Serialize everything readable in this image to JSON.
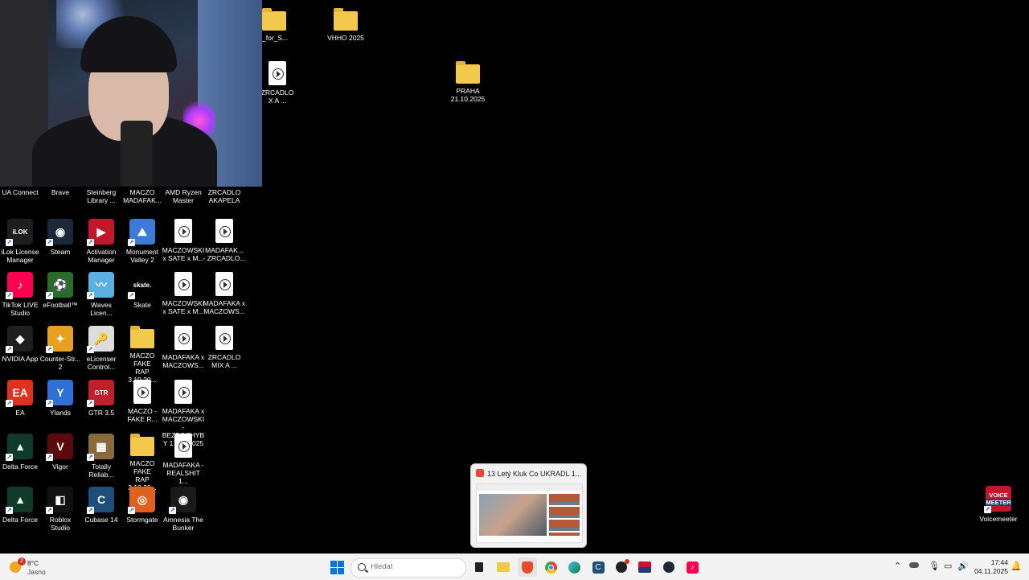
{
  "desktop": {
    "top_icons": [
      {
        "label": "_for_S..."
      },
      {
        "label": "VHHO 2025"
      },
      {
        "label": "ZRCADLO\nX A ..."
      },
      {
        "label": "PRAHA\n21.10.2025"
      }
    ],
    "grid": [
      [
        {
          "label": "UA Connect",
          "type": "app",
          "color": "#111111",
          "glyph": ""
        },
        {
          "label": "Brave",
          "type": "app",
          "color": "#e74a2d",
          "glyph": ""
        },
        {
          "label": "Steinberg\nLibrary ...",
          "type": "app",
          "color": "#333333",
          "glyph": ""
        },
        {
          "label": "MACZO\nMADAFAK...",
          "type": "app",
          "color": "#222222",
          "glyph": ""
        },
        {
          "label": "AMD Ryzen\nMaster",
          "type": "app",
          "color": "#222222",
          "glyph": ""
        },
        {
          "label": "ZRCADLO\nAKAPELA",
          "type": "app",
          "color": "#222222",
          "glyph": ""
        }
      ],
      [
        {
          "label": "iLok License\nManager",
          "type": "app",
          "color": "#1e1e1e",
          "glyph": "iLOK"
        },
        {
          "label": "Steam",
          "type": "app",
          "color": "#1b2838",
          "glyph": "◉"
        },
        {
          "label": "Activation\nManager",
          "type": "app",
          "color": "#c4162a",
          "glyph": "▶"
        },
        {
          "label": "Monument\nValley 2",
          "type": "app",
          "color": "#3a7bd5",
          "glyph": "⛰"
        },
        {
          "label": "MACZOWSKI\nx SATE x M...",
          "type": "file"
        },
        {
          "label": "MADAFAK...\n- ZRCADLO...",
          "type": "file"
        }
      ],
      [
        {
          "label": "TikTok LIVE\nStudio",
          "type": "app",
          "color": "#ff0050",
          "glyph": "♪"
        },
        {
          "label": "eFootball™",
          "type": "app",
          "color": "#2a6b2a",
          "glyph": "⚽"
        },
        {
          "label": "Waves\nLicen...",
          "type": "app",
          "color": "#5ab0e0",
          "glyph": "〰"
        },
        {
          "label": "Skate",
          "type": "app",
          "color": "#000000",
          "glyph": "skate."
        },
        {
          "label": "MACZOWSKI\nx SATE x M...",
          "type": "file"
        },
        {
          "label": "MADAFAKA x\nMACZOWS...",
          "type": "file"
        }
      ],
      [
        {
          "label": "NVIDIA App",
          "type": "app",
          "color": "#1f1f1f",
          "glyph": "◆"
        },
        {
          "label": "Counter-Str...\n2",
          "type": "app",
          "color": "#e8a020",
          "glyph": "✦"
        },
        {
          "label": "eLicenser\nControl...",
          "type": "app",
          "color": "#dddddd",
          "glyph": "🔑"
        },
        {
          "label": "MACZO FAKE\nRAP 3.10.20...",
          "type": "folder"
        },
        {
          "label": "MADAFAKA x\nMACZOWS...",
          "type": "file"
        },
        {
          "label": "ZRCADLO\nMIX A ...",
          "type": "file"
        }
      ],
      [
        {
          "label": "EA",
          "type": "app",
          "color": "#e0301e",
          "glyph": "EA"
        },
        {
          "label": "Ylands",
          "type": "app",
          "color": "#2e6fd8",
          "glyph": "Y"
        },
        {
          "label": "GTR 3.5",
          "type": "app",
          "color": "#c0202a",
          "glyph": "GTR"
        },
        {
          "label": "MACZO -\nFAKE R...",
          "type": "file"
        },
        {
          "label": "MADAFAKA x\nMACZOWSKI\n- BEZPOCHYB\nY 17.10.2025",
          "type": "file"
        }
      ],
      [
        {
          "label": "Delta Force",
          "type": "app",
          "color": "#0f3b2a",
          "glyph": "▲"
        },
        {
          "label": "Vigor",
          "type": "app",
          "color": "#5a0a0a",
          "glyph": "V"
        },
        {
          "label": "Totally\nReliab...",
          "type": "app",
          "color": "#8a6a3a",
          "glyph": "▦"
        },
        {
          "label": "MACZO FAKE\nRAP 3.10.20...",
          "type": "folder"
        },
        {
          "label": "MADAFAKA -\nREALSHIT 1...",
          "type": "file"
        }
      ],
      [
        {
          "label": "Delta Force",
          "type": "app",
          "color": "#0f3b2a",
          "glyph": "▲"
        },
        {
          "label": "Roblox\nStudio",
          "type": "app",
          "color": "#111111",
          "glyph": "◧"
        },
        {
          "label": "Cubase 14",
          "type": "app",
          "color": "#1f4e7a",
          "glyph": "C"
        },
        {
          "label": "Stormgate",
          "type": "app",
          "color": "#e0601e",
          "glyph": "◎"
        },
        {
          "label": "Amnesia The\nBunker",
          "type": "app",
          "color": "#1a1a1a",
          "glyph": "◉"
        }
      ]
    ],
    "voicemeeter": {
      "label": "Voicemeeter",
      "logo_top": "VOICE",
      "logo_bottom": "MEETER"
    }
  },
  "preview": {
    "title": "13 Letý Kluk Co UKRADL 1..."
  },
  "taskbar": {
    "weather": {
      "temp": "8°C",
      "condition": "Jasno",
      "badge": "2"
    },
    "search": {
      "placeholder": "Hledat"
    },
    "apps": [
      {
        "name": "task-view-icon"
      },
      {
        "name": "file-explorer-icon"
      },
      {
        "name": "brave-icon"
      },
      {
        "name": "chrome-icon"
      },
      {
        "name": "edge-icon"
      },
      {
        "name": "cubase-icon"
      },
      {
        "name": "obs-icon"
      },
      {
        "name": "voicemeeter-icon"
      },
      {
        "name": "steam-icon"
      },
      {
        "name": "tiktok-icon"
      }
    ],
    "clock": {
      "time": "17:44",
      "date": "04.11.2025"
    }
  }
}
